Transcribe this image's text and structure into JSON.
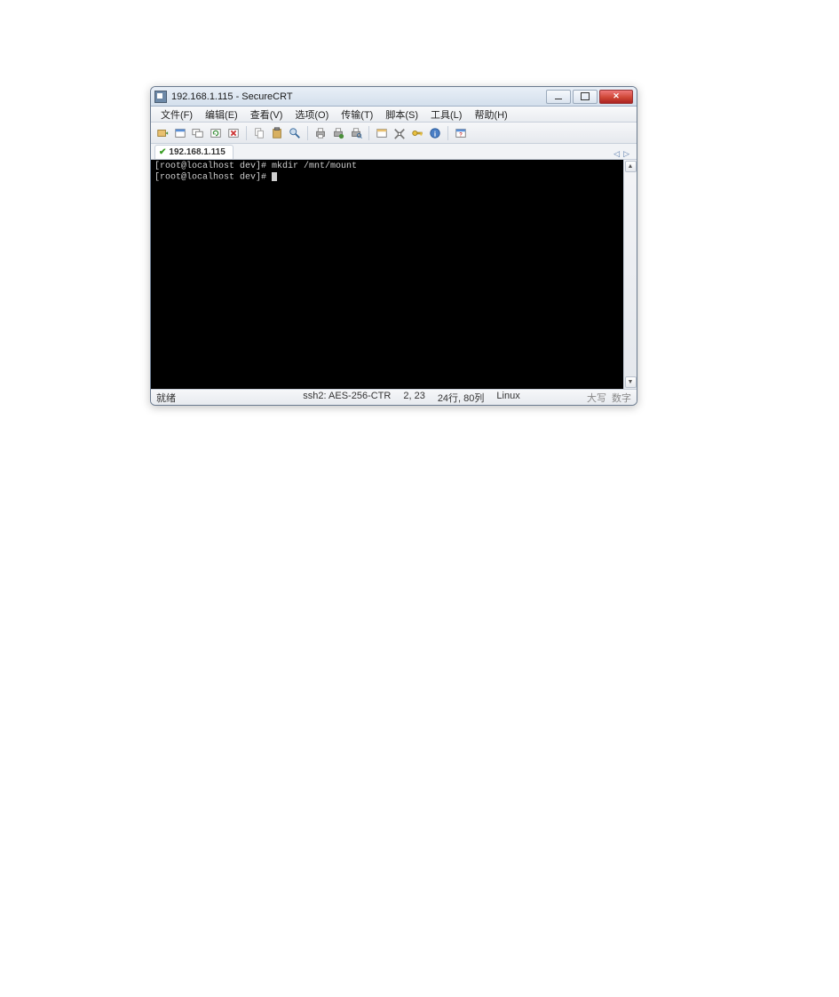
{
  "window": {
    "title": "192.168.1.115 - SecureCRT"
  },
  "menu": {
    "file": "文件(F)",
    "edit": "编辑(E)",
    "view": "查看(V)",
    "options": "选项(O)",
    "transfer": "传输(T)",
    "script": "脚本(S)",
    "tools": "工具(L)",
    "help": "帮助(H)"
  },
  "tab": {
    "label": "192.168.1.115"
  },
  "terminal": {
    "line1_prompt": "[root@localhost dev]# ",
    "line1_cmd": "mkdir /mnt/mount",
    "line2_prompt": "[root@localhost dev]# "
  },
  "status": {
    "ready": "就绪",
    "conn": "ssh2: AES-256-CTR",
    "pos": "2, 23",
    "size": "24行, 80列",
    "term": "Linux",
    "caps": "大写",
    "num": "数字"
  },
  "icons": {
    "quick_connect": "quick-connect",
    "new_session": "new-session",
    "session_manager": "session-manager",
    "reconnect": "reconnect",
    "disconnect": "disconnect",
    "copy": "copy",
    "paste": "paste",
    "find": "find",
    "print": "print",
    "print_setup": "print-setup",
    "print_preview": "print-preview",
    "new_window": "new-window",
    "settings": "settings",
    "key": "key",
    "info": "info",
    "help": "help"
  }
}
